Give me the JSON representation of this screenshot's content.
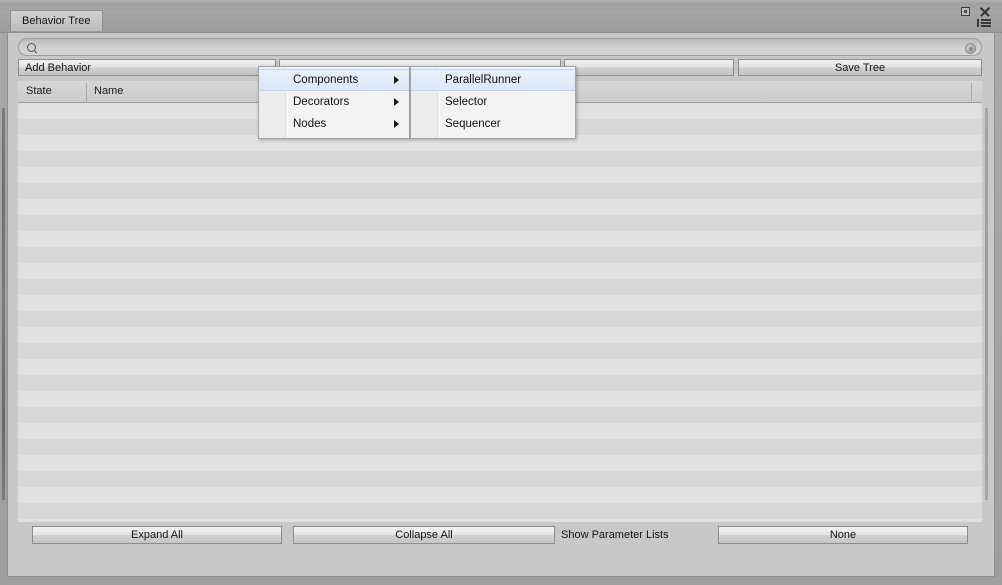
{
  "window": {
    "tab_label": "Behavior Tree",
    "controls": {
      "maximize": "maximize-icon",
      "close": "close-icon",
      "menu": "menu-icon"
    }
  },
  "search": {
    "placeholder": "",
    "value": "",
    "icon": "search-icon",
    "clear_icon": "clear-icon"
  },
  "toolbar": {
    "add_behavior_label": "Add Behavior",
    "dropdown_two_label": "",
    "dropdown_three_label": "",
    "save_tree_label": "Save Tree"
  },
  "list_header": {
    "state": "State",
    "name": "Name"
  },
  "context_menu": {
    "items": [
      {
        "label": "Components",
        "has_submenu": true,
        "selected": true
      },
      {
        "label": "Decorators",
        "has_submenu": true,
        "selected": false
      },
      {
        "label": "Nodes",
        "has_submenu": true,
        "selected": false
      }
    ]
  },
  "submenu_components": {
    "items": [
      {
        "label": "ParallelRunner",
        "selected": true
      },
      {
        "label": "Selector",
        "selected": false
      },
      {
        "label": "Sequencer",
        "selected": false
      }
    ]
  },
  "bottom_toolbar": {
    "expand_all_label": "Expand All",
    "collapse_all_label": "Collapse All",
    "show_parameter_lists_label": "Show Parameter Lists",
    "parameter_lists_value": "None"
  },
  "colors": {
    "panel_bg": "#c8c8c8",
    "chrome_bg": "#a3a3a3",
    "row_light": "#e0e0e0",
    "row_dark": "#d8d8d8",
    "menu_bg": "#f3f3f3",
    "menu_highlight": "#dbe8f8"
  }
}
